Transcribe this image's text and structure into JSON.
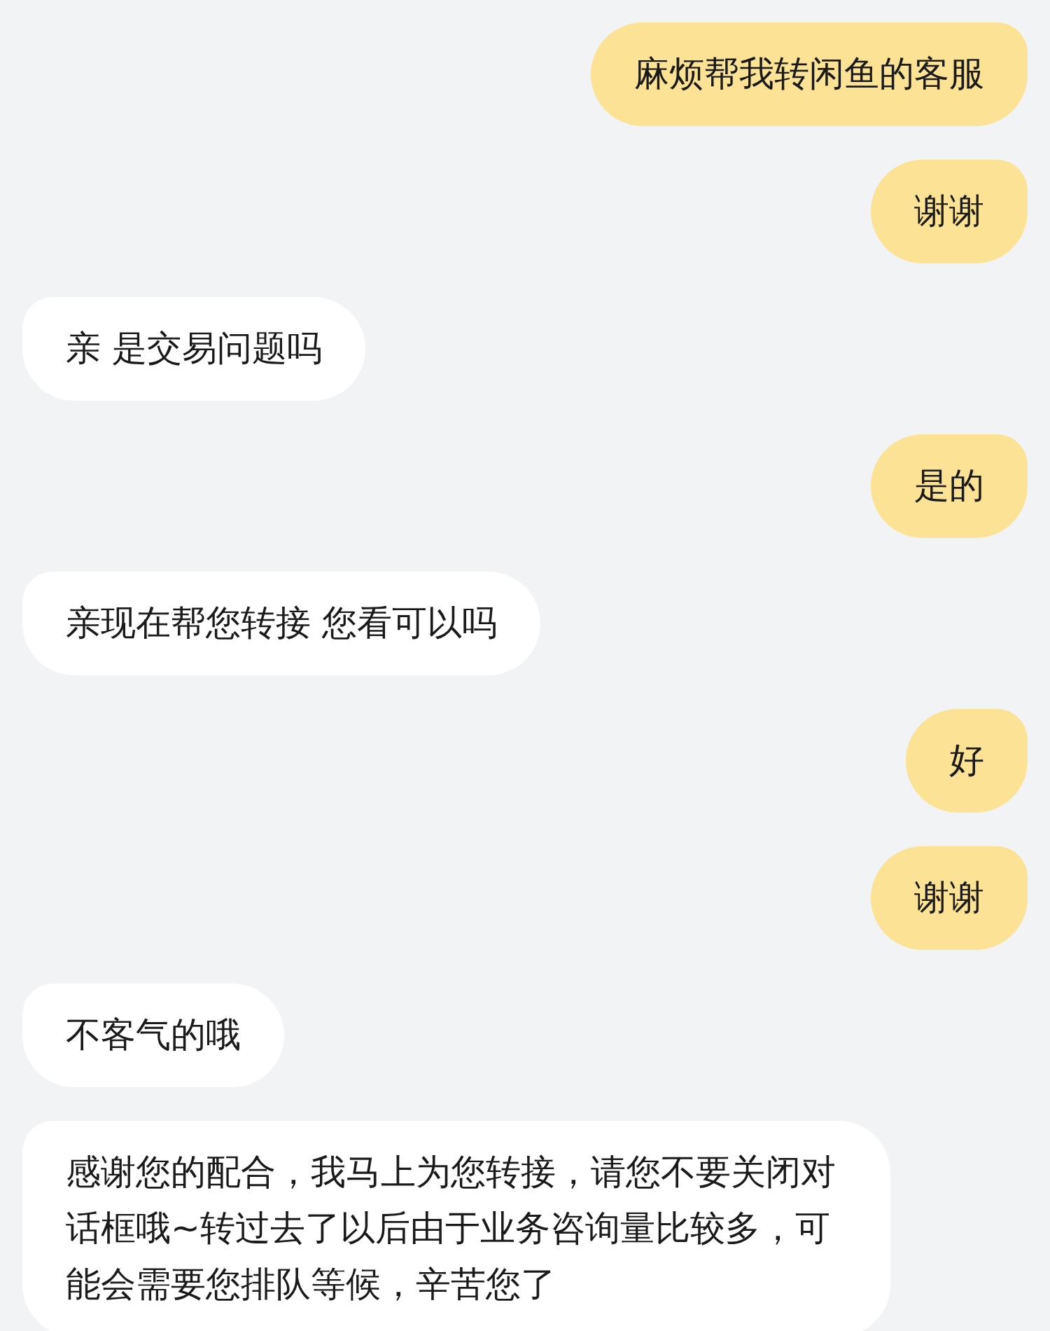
{
  "messages": [
    {
      "outgoing": true,
      "text": "麻烦帮我转闲鱼的客服"
    },
    {
      "outgoing": true,
      "text": "谢谢"
    },
    {
      "outgoing": false,
      "text": "亲 是交易问题吗"
    },
    {
      "outgoing": true,
      "text": "是的"
    },
    {
      "outgoing": false,
      "text": "亲现在帮您转接 您看可以吗"
    },
    {
      "outgoing": true,
      "text": "好"
    },
    {
      "outgoing": true,
      "text": "谢谢"
    },
    {
      "outgoing": false,
      "text": "不客气的哦"
    },
    {
      "outgoing": false,
      "text": "感谢您的配合，我马上为您转接，请您不要关闭对话框哦~转过去了以后由于业务咨询量比较多，可能会需要您排队等候，辛苦您了"
    }
  ]
}
